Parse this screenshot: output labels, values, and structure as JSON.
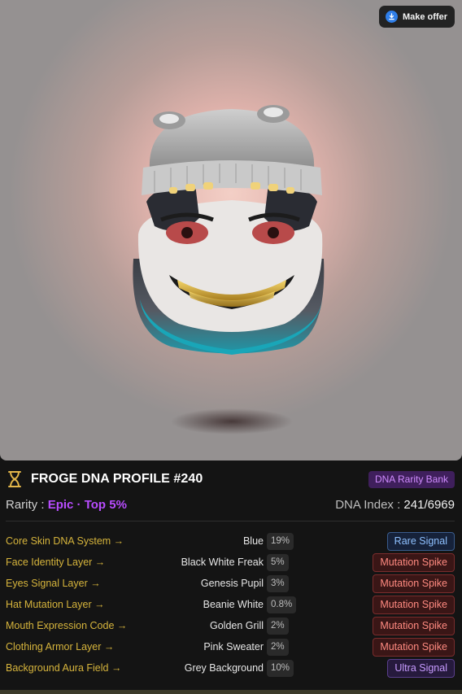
{
  "offer": {
    "label": "Make offer",
    "icon": "download-arrow-icon",
    "accent": "#2f7ee8"
  },
  "nft_image": {
    "alt": "FROGE NFT #240"
  },
  "profile": {
    "icon": "hourglass-icon",
    "title": "FROGE DNA PROFILE #240",
    "badge": "DNA Rarity Bank",
    "rarity_label": "Rarity : ",
    "rarity_value": "Epic · Top 5%",
    "index_label": "DNA Index : ",
    "index_value": "241/6969"
  },
  "traits": [
    {
      "label": "Core Skin DNA System →",
      "value": "Blue",
      "pct": "19%",
      "tag": "Rare Signal",
      "tag_kind": "rare"
    },
    {
      "label": "Face Identity Layer →",
      "value": "Black White Freak",
      "pct": "5%",
      "tag": "Mutation Spike",
      "tag_kind": "mut"
    },
    {
      "label": "Eyes Signal Layer →",
      "value": "Genesis Pupil",
      "pct": "3%",
      "tag": "Mutation Spike",
      "tag_kind": "mut"
    },
    {
      "label": "Hat Mutation Layer →",
      "value": "Beanie White",
      "pct": "0.8%",
      "tag": "Mutation Spike",
      "tag_kind": "mut"
    },
    {
      "label": "Mouth Expression Code →",
      "value": "Golden Grill",
      "pct": "2%",
      "tag": "Mutation Spike",
      "tag_kind": "mut"
    },
    {
      "label": "Clothing Armor Layer →",
      "value": "Pink Sweater",
      "pct": "2%",
      "tag": "Mutation Spike",
      "tag_kind": "mut"
    },
    {
      "label": "Background Aura Field →",
      "value": "Grey Background",
      "pct": "10%",
      "tag": "Ultra Signal",
      "tag_kind": "ultra"
    }
  ],
  "colors": {
    "label_gold": "#d6b43c",
    "rarity_purple": "#b84cff",
    "badge_purple": "#d08cff",
    "rare_blue": "#8fc1ff",
    "mutation_red": "#ff8a80",
    "ultra_violet": "#c79bff"
  }
}
